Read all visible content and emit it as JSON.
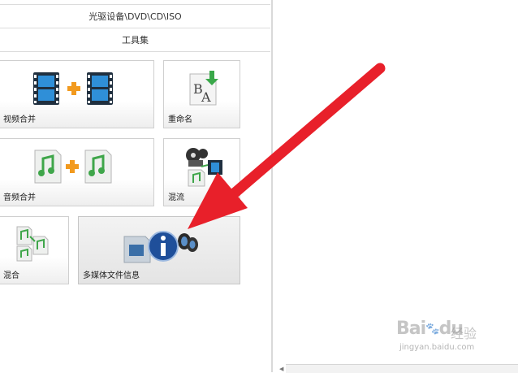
{
  "categories": {
    "optical": "光驱设备\\DVD\\CD\\ISO",
    "tools": "工具集"
  },
  "tools": [
    {
      "label": "视频合并",
      "icon": "video-merge-icon"
    },
    {
      "label": "重命名",
      "icon": "rename-icon"
    },
    {
      "label": "音频合并",
      "icon": "audio-merge-icon"
    },
    {
      "label": "混流",
      "icon": "mux-icon"
    },
    {
      "label": "混合",
      "icon": "mix-icon"
    },
    {
      "label": "多媒体文件信息",
      "icon": "media-info-icon",
      "selected": true
    }
  ],
  "annotation": {
    "arrow_color": "#e8202a"
  },
  "watermark": {
    "logo": "Bai",
    "logo_suffix": "du",
    "text": "经验",
    "url": "jingyan.baidu.com"
  }
}
